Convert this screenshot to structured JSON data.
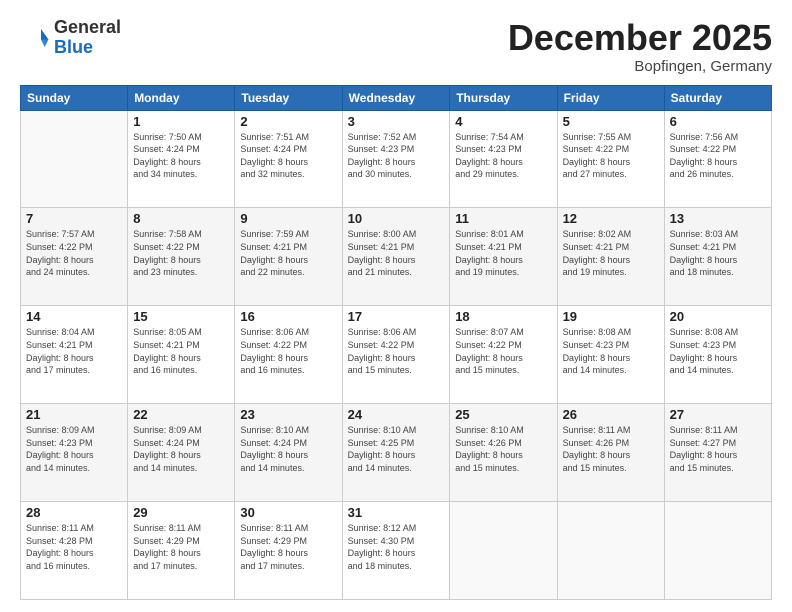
{
  "logo": {
    "general": "General",
    "blue": "Blue"
  },
  "header": {
    "month": "December 2025",
    "location": "Bopfingen, Germany"
  },
  "weekdays": [
    "Sunday",
    "Monday",
    "Tuesday",
    "Wednesday",
    "Thursday",
    "Friday",
    "Saturday"
  ],
  "weeks": [
    [
      {
        "day": "",
        "info": ""
      },
      {
        "day": "1",
        "info": "Sunrise: 7:50 AM\nSunset: 4:24 PM\nDaylight: 8 hours\nand 34 minutes."
      },
      {
        "day": "2",
        "info": "Sunrise: 7:51 AM\nSunset: 4:24 PM\nDaylight: 8 hours\nand 32 minutes."
      },
      {
        "day": "3",
        "info": "Sunrise: 7:52 AM\nSunset: 4:23 PM\nDaylight: 8 hours\nand 30 minutes."
      },
      {
        "day": "4",
        "info": "Sunrise: 7:54 AM\nSunset: 4:23 PM\nDaylight: 8 hours\nand 29 minutes."
      },
      {
        "day": "5",
        "info": "Sunrise: 7:55 AM\nSunset: 4:22 PM\nDaylight: 8 hours\nand 27 minutes."
      },
      {
        "day": "6",
        "info": "Sunrise: 7:56 AM\nSunset: 4:22 PM\nDaylight: 8 hours\nand 26 minutes."
      }
    ],
    [
      {
        "day": "7",
        "info": "Sunrise: 7:57 AM\nSunset: 4:22 PM\nDaylight: 8 hours\nand 24 minutes."
      },
      {
        "day": "8",
        "info": "Sunrise: 7:58 AM\nSunset: 4:22 PM\nDaylight: 8 hours\nand 23 minutes."
      },
      {
        "day": "9",
        "info": "Sunrise: 7:59 AM\nSunset: 4:21 PM\nDaylight: 8 hours\nand 22 minutes."
      },
      {
        "day": "10",
        "info": "Sunrise: 8:00 AM\nSunset: 4:21 PM\nDaylight: 8 hours\nand 21 minutes."
      },
      {
        "day": "11",
        "info": "Sunrise: 8:01 AM\nSunset: 4:21 PM\nDaylight: 8 hours\nand 19 minutes."
      },
      {
        "day": "12",
        "info": "Sunrise: 8:02 AM\nSunset: 4:21 PM\nDaylight: 8 hours\nand 19 minutes."
      },
      {
        "day": "13",
        "info": "Sunrise: 8:03 AM\nSunset: 4:21 PM\nDaylight: 8 hours\nand 18 minutes."
      }
    ],
    [
      {
        "day": "14",
        "info": "Sunrise: 8:04 AM\nSunset: 4:21 PM\nDaylight: 8 hours\nand 17 minutes."
      },
      {
        "day": "15",
        "info": "Sunrise: 8:05 AM\nSunset: 4:21 PM\nDaylight: 8 hours\nand 16 minutes."
      },
      {
        "day": "16",
        "info": "Sunrise: 8:06 AM\nSunset: 4:22 PM\nDaylight: 8 hours\nand 16 minutes."
      },
      {
        "day": "17",
        "info": "Sunrise: 8:06 AM\nSunset: 4:22 PM\nDaylight: 8 hours\nand 15 minutes."
      },
      {
        "day": "18",
        "info": "Sunrise: 8:07 AM\nSunset: 4:22 PM\nDaylight: 8 hours\nand 15 minutes."
      },
      {
        "day": "19",
        "info": "Sunrise: 8:08 AM\nSunset: 4:23 PM\nDaylight: 8 hours\nand 14 minutes."
      },
      {
        "day": "20",
        "info": "Sunrise: 8:08 AM\nSunset: 4:23 PM\nDaylight: 8 hours\nand 14 minutes."
      }
    ],
    [
      {
        "day": "21",
        "info": "Sunrise: 8:09 AM\nSunset: 4:23 PM\nDaylight: 8 hours\nand 14 minutes."
      },
      {
        "day": "22",
        "info": "Sunrise: 8:09 AM\nSunset: 4:24 PM\nDaylight: 8 hours\nand 14 minutes."
      },
      {
        "day": "23",
        "info": "Sunrise: 8:10 AM\nSunset: 4:24 PM\nDaylight: 8 hours\nand 14 minutes."
      },
      {
        "day": "24",
        "info": "Sunrise: 8:10 AM\nSunset: 4:25 PM\nDaylight: 8 hours\nand 14 minutes."
      },
      {
        "day": "25",
        "info": "Sunrise: 8:10 AM\nSunset: 4:26 PM\nDaylight: 8 hours\nand 15 minutes."
      },
      {
        "day": "26",
        "info": "Sunrise: 8:11 AM\nSunset: 4:26 PM\nDaylight: 8 hours\nand 15 minutes."
      },
      {
        "day": "27",
        "info": "Sunrise: 8:11 AM\nSunset: 4:27 PM\nDaylight: 8 hours\nand 15 minutes."
      }
    ],
    [
      {
        "day": "28",
        "info": "Sunrise: 8:11 AM\nSunset: 4:28 PM\nDaylight: 8 hours\nand 16 minutes."
      },
      {
        "day": "29",
        "info": "Sunrise: 8:11 AM\nSunset: 4:29 PM\nDaylight: 8 hours\nand 17 minutes."
      },
      {
        "day": "30",
        "info": "Sunrise: 8:11 AM\nSunset: 4:29 PM\nDaylight: 8 hours\nand 17 minutes."
      },
      {
        "day": "31",
        "info": "Sunrise: 8:12 AM\nSunset: 4:30 PM\nDaylight: 8 hours\nand 18 minutes."
      },
      {
        "day": "",
        "info": ""
      },
      {
        "day": "",
        "info": ""
      },
      {
        "day": "",
        "info": ""
      }
    ]
  ]
}
